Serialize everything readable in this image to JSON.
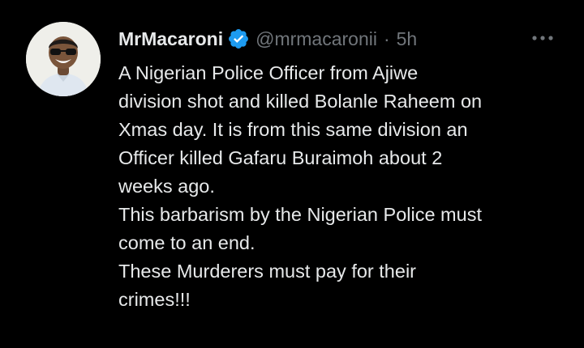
{
  "tweet": {
    "display_name": "MrMacaroni",
    "handle": "@mrmacaronii",
    "separator": "·",
    "time": "5h",
    "verified": true,
    "avatar_icon": "profile-photo",
    "more_icon": "more-options-icon",
    "colors": {
      "background": "#000000",
      "text": "#e7e9ea",
      "muted": "#71767b",
      "verified": "#1d9bf0"
    },
    "text_lines": [
      "A Nigerian Police Officer from Ajiwe",
      "division shot and killed Bolanle Raheem on",
      "Xmas day. It is from this same division an",
      "Officer killed Gafaru Buraimoh about 2",
      "weeks ago.",
      "This barbarism by the Nigerian Police must",
      "come to an end.",
      "These Murderers must pay for their",
      "crimes!!!"
    ]
  }
}
